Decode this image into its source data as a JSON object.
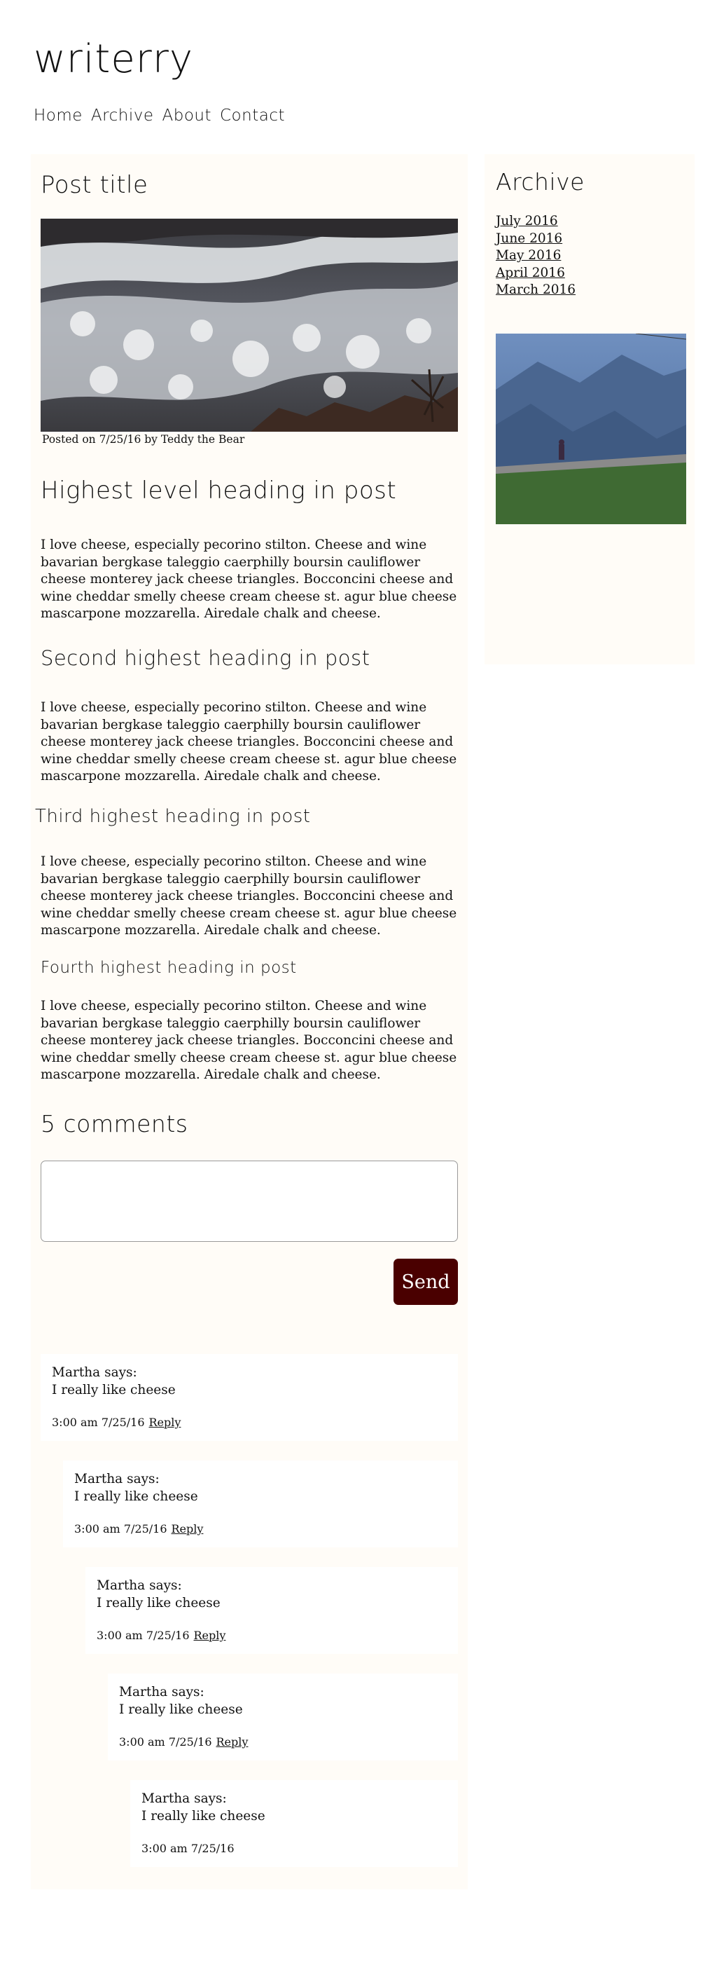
{
  "site": {
    "logo": "writerry"
  },
  "nav": [
    "Home",
    "Archive",
    "About",
    "Contact"
  ],
  "post": {
    "title": "Post title",
    "meta": "Posted on 7/25/16 by Teddy the Bear",
    "sections": [
      {
        "heading": "Highest level heading in post",
        "text": "I love cheese, especially pecorino stilton. Cheese and wine bavarian bergkase taleggio caerphilly boursin cauliflower cheese monterey jack cheese triangles. Bocconcini cheese and wine cheddar smelly cheese cream cheese st. agur blue cheese mascarpone mozzarella. Airedale chalk and cheese."
      },
      {
        "heading": "Second highest heading in post",
        "text": "I love cheese, especially pecorino stilton. Cheese and wine bavarian bergkase taleggio caerphilly boursin cauliflower cheese monterey jack cheese triangles. Bocconcini cheese and wine cheddar smelly cheese cream cheese st. agur blue cheese mascarpone mozzarella. Airedale chalk and cheese."
      },
      {
        "heading": "Third highest heading in post",
        "text": "I love cheese, especially pecorino stilton. Cheese and wine bavarian bergkase taleggio caerphilly boursin cauliflower cheese monterey jack cheese triangles. Bocconcini cheese and wine cheddar smelly cheese cream cheese st. agur blue cheese mascarpone mozzarella. Airedale chalk and cheese."
      },
      {
        "heading": "Fourth highest heading in post",
        "text": "I love cheese, especially pecorino stilton. Cheese and wine bavarian bergkase taleggio caerphilly boursin cauliflower cheese monterey jack cheese triangles. Bocconcini cheese and wine cheddar smelly cheese cream cheese st. agur blue cheese mascarpone mozzarella. Airedale chalk and cheese."
      }
    ]
  },
  "comments": {
    "title": "5 comments",
    "input_value": "",
    "send_label": "Send",
    "items": [
      {
        "author": "Martha says:",
        "text": "I really like cheese",
        "time": "3:00 am 7/25/16",
        "reply": "Reply"
      },
      {
        "author": "Martha says:",
        "text": "I really like cheese",
        "time": "3:00 am 7/25/16",
        "reply": "Reply"
      },
      {
        "author": "Martha says:",
        "text": "I really like cheese",
        "time": "3:00 am 7/25/16",
        "reply": "Reply"
      },
      {
        "author": "Martha says:",
        "text": "I really like cheese",
        "time": "3:00 am 7/25/16",
        "reply": "Reply"
      },
      {
        "author": "Martha says:",
        "text": "I really like cheese",
        "time": "3:00 am 7/25/16",
        "reply": ""
      }
    ]
  },
  "sidebar": {
    "archive_title": "Archive",
    "months": [
      "July 2016",
      "June 2016",
      "May 2016",
      "April 2016",
      "March 2016"
    ]
  },
  "colors": {
    "panel_bg": "#fffcf7",
    "send_button": "#4a0000"
  }
}
